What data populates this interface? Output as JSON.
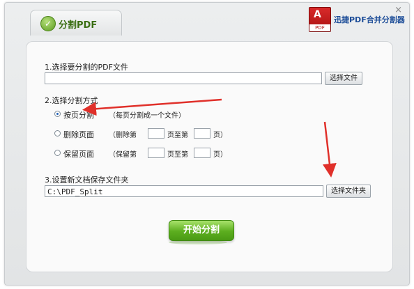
{
  "window": {
    "close_glyph": "×"
  },
  "tab": {
    "title": "分割PDF",
    "icon": "leaf-icon"
  },
  "brand": {
    "logo_text": "A",
    "logo_sub": "PDF",
    "name": "迅捷PDF合并分割器"
  },
  "sections": {
    "file_select": {
      "label": "1.选择要分割的PDF文件",
      "input_value": "",
      "button": "选择文件"
    },
    "split_mode": {
      "label": "2.选择分割方式",
      "options": [
        {
          "label": "按页分割",
          "hint": "（每页分割成一个文件）",
          "checked": true
        },
        {
          "label": "删除页面",
          "hint_prefix": "（删除第",
          "hint_mid": "页至第",
          "hint_suffix": "页）",
          "checked": false
        },
        {
          "label": "保留页面",
          "hint_prefix": "（保留第",
          "hint_mid": "页至第",
          "hint_suffix": "页）",
          "checked": false
        }
      ]
    },
    "output_folder": {
      "label": "3.设置新文档保存文件夹",
      "input_value": "C:\\PDF_Split",
      "button": "选择文件夹"
    }
  },
  "start_button": {
    "label": "开始分割"
  },
  "colors": {
    "accent_green": "#5cae1f",
    "annotation_red": "#e0302a",
    "brand_blue": "#1f4f99"
  }
}
